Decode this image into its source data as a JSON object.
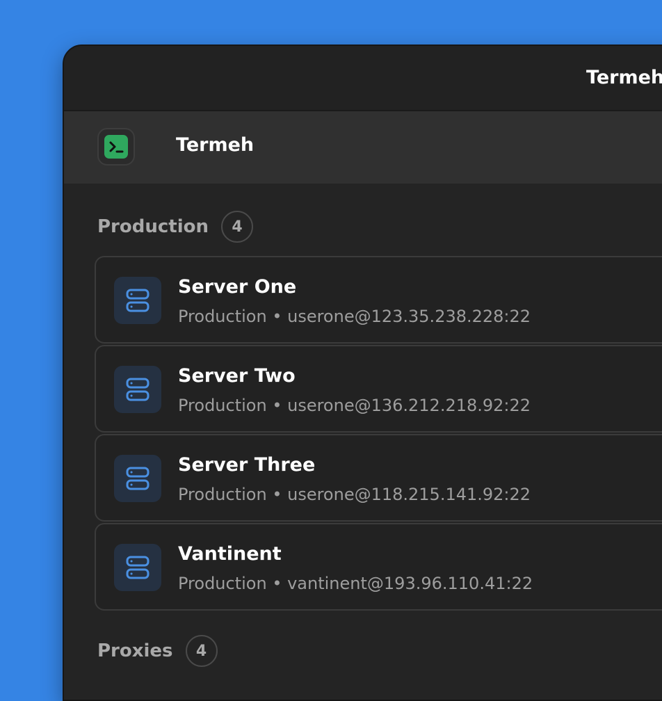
{
  "window": {
    "title": "Termeh"
  },
  "header": {
    "app_title": "Termeh",
    "app_icon": "terminal-icon"
  },
  "sections": [
    {
      "title": "Production",
      "count": "4",
      "servers": [
        {
          "name": "Server One",
          "subtitle": "Production • userone@123.35.238.228:22",
          "icon": "server-icon"
        },
        {
          "name": "Server Two",
          "subtitle": "Production • userone@136.212.218.92:22",
          "icon": "server-icon"
        },
        {
          "name": "Server Three",
          "subtitle": "Production • userone@118.215.141.92:22",
          "icon": "server-icon"
        },
        {
          "name": "Vantinent",
          "subtitle": "Production • vantinent@193.96.110.41:22",
          "icon": "server-icon"
        }
      ]
    },
    {
      "title": "Proxies",
      "count": "4"
    }
  ],
  "colors": {
    "desktop_background": "#3584e4",
    "window_background": "#242424",
    "header_background": "#303030",
    "server_icon_accent": "#4a90e2",
    "terminal_icon_green": "#2fa85e"
  }
}
